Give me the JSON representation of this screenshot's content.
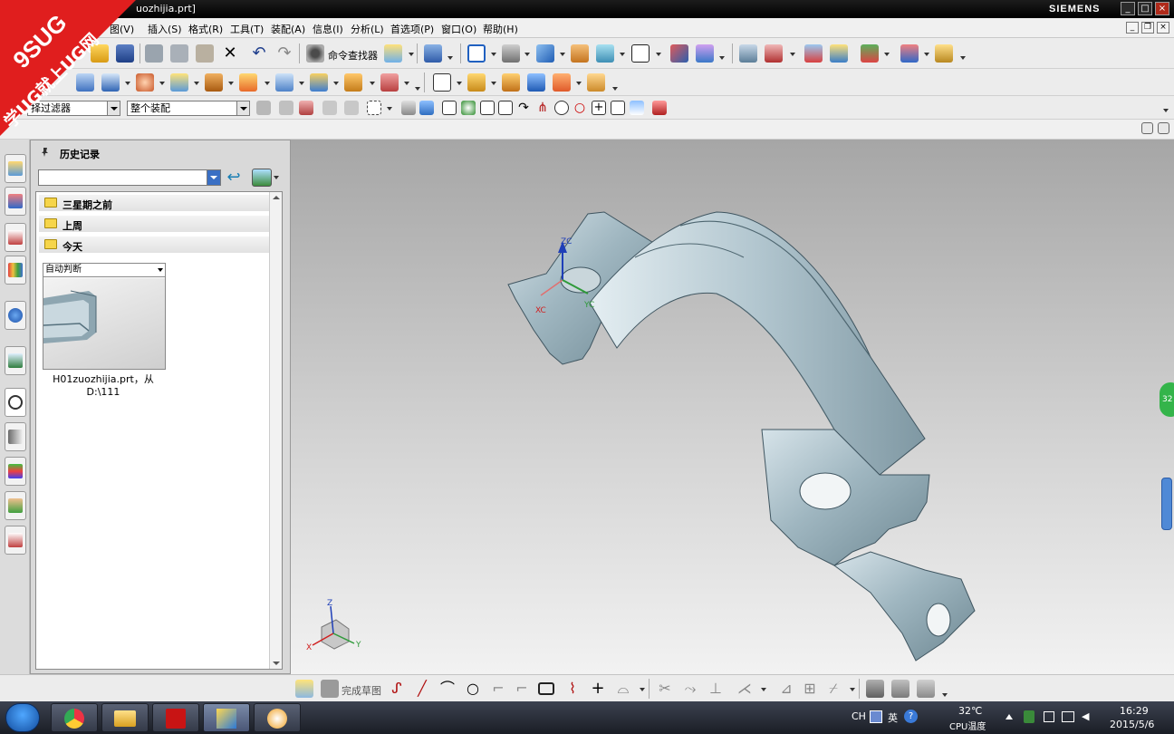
{
  "window": {
    "title": "uozhijia.prt]",
    "brand": "SIEMENS",
    "controls": [
      "_",
      "□",
      "×"
    ]
  },
  "logo": {
    "line1": "9SUG",
    "line2": "学UG就上UG网"
  },
  "menu": {
    "items": [
      "图(V)",
      "插入(S)",
      "格式(R)",
      "工具(T)",
      "装配(A)",
      "信息(I)",
      "分析(L)",
      "首选项(P)",
      "窗口(O)",
      "帮助(H)"
    ],
    "mdi_controls": [
      "_",
      "❐",
      "×"
    ]
  },
  "toolbar": {
    "command_finder": "命令查找器",
    "selection_filter": "择过滤器",
    "assembly_scope": "整个装配"
  },
  "history_panel": {
    "title": "历史记录",
    "groups": [
      "三星期之前",
      "上周",
      "今天"
    ],
    "thumbnail_mode": "自动判断",
    "file_caption_line1": "H01zuozhijia.prt，从",
    "file_caption_line2": "D:\\111"
  },
  "viewport": {
    "datum_labels": {
      "zc": "ZC",
      "xc": "XC",
      "yc": "YC"
    },
    "triad_labels": {
      "z": "Z",
      "x": "X",
      "y": "Y"
    },
    "side_badge": "32"
  },
  "sketch_toolbar": {
    "finish_sketch": "完成草图"
  },
  "taskbar": {
    "ime": "CH",
    "lang": "英",
    "temperature": "32℃",
    "temp_label": "CPU温度",
    "time": "16:29",
    "date": "2015/5/6"
  },
  "colors": {
    "titlebar": "#000000",
    "model_body": "#8fa7b2",
    "model_highlight": "#d9e6ec",
    "viewport_top": "#a6a6a6",
    "viewport_bottom": "#f2f2f2",
    "logo_red": "#e01e1e"
  }
}
